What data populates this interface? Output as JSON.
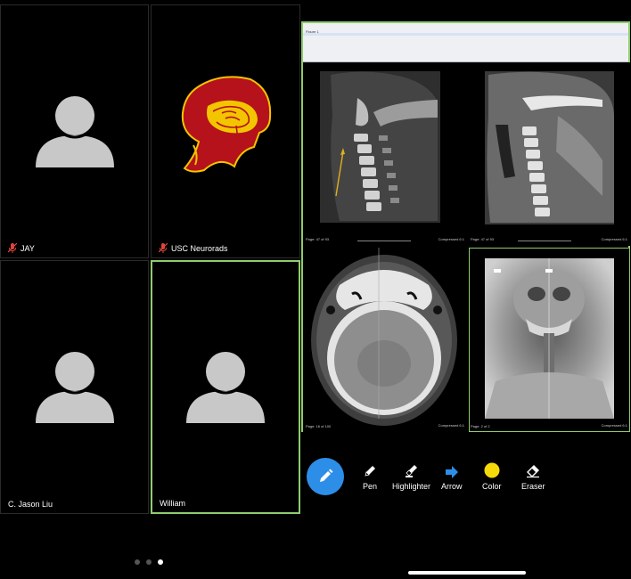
{
  "participants": [
    {
      "name": "JAY",
      "muted": true,
      "avatar": "person-silhouette"
    },
    {
      "name": "USC Neurorads",
      "muted": true,
      "avatar": "trojan-brain-logo"
    },
    {
      "name": "C. Jason Liu",
      "muted": false,
      "avatar": "person-silhouette"
    },
    {
      "name": "William",
      "muted": false,
      "avatar": "person-silhouette",
      "active_speaker": true
    }
  ],
  "pager": {
    "pages": 3,
    "current": 3
  },
  "viewer": {
    "window_title": "Figure 1",
    "panes": [
      {
        "label": "Page: 47 of 93",
        "series": "Compressed 6:1",
        "view": "sagittal-bone"
      },
      {
        "label": "Page: 47 of 93",
        "series": "Compressed 6:1",
        "view": "sagittal-soft-tissue"
      },
      {
        "label": "Page: 16 of 100",
        "series": "Compressed 6:1",
        "view": "axial"
      },
      {
        "label": "Page: 2 of 2",
        "series": "Compressed 6:1",
        "view": "scout"
      }
    ]
  },
  "toolbar": {
    "main_icon": "pencil-icon",
    "tools": [
      {
        "label": "Pen",
        "icon": "pen-icon"
      },
      {
        "label": "Highlighter",
        "icon": "highlighter-icon"
      },
      {
        "label": "Arrow",
        "icon": "arrow-icon",
        "color": "#2d8ee8"
      },
      {
        "label": "Color",
        "icon": "color-dot-icon",
        "color": "#f5d90a"
      },
      {
        "label": "Eraser",
        "icon": "eraser-icon"
      }
    ]
  },
  "colors": {
    "active_border": "#8fcc6d",
    "accent_blue": "#2d8ee8",
    "usc_cardinal": "#b5121b",
    "usc_gold": "#f2c500"
  }
}
